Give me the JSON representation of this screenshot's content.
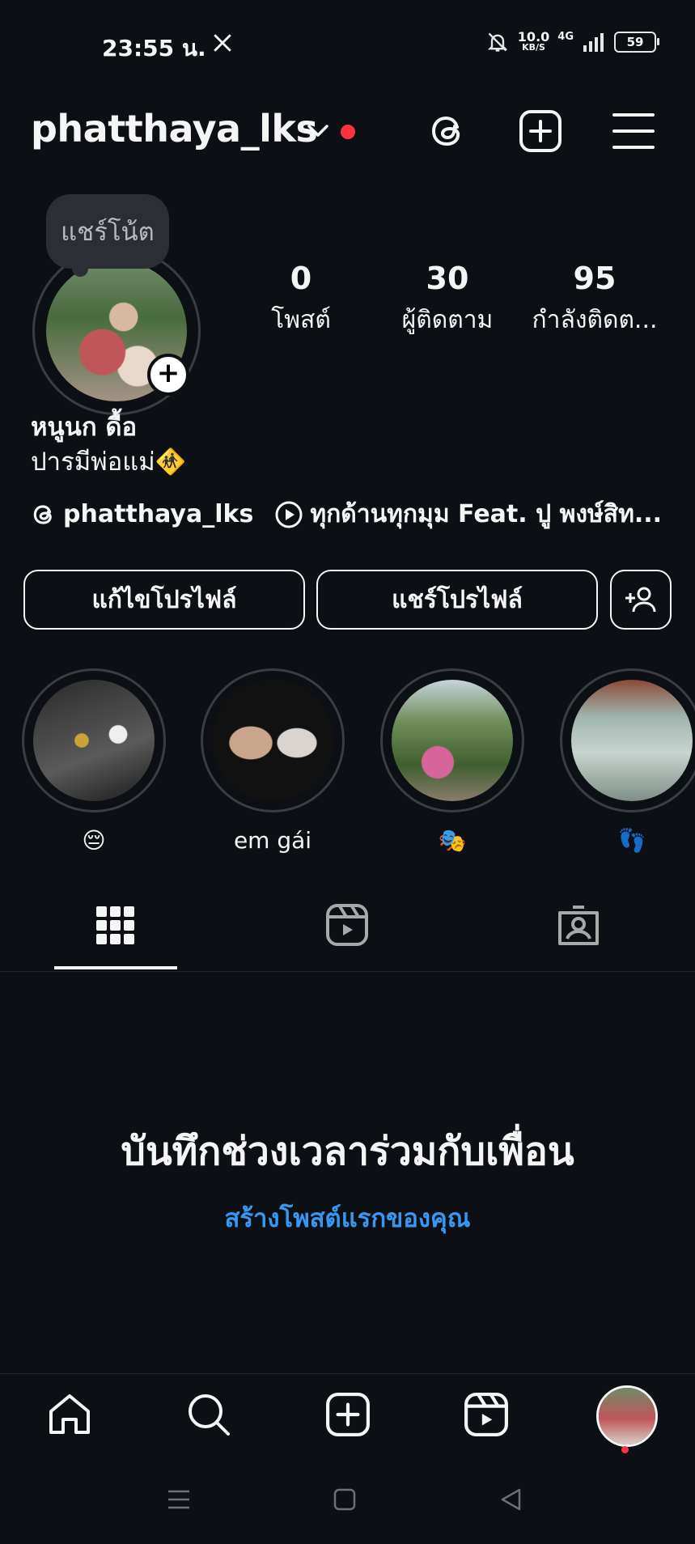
{
  "status": {
    "time": "23:55 น.",
    "net_speed_value": "10.0",
    "net_speed_unit": "KB/S",
    "network": "4G",
    "battery": "59"
  },
  "header": {
    "username": "phatthaya_lks"
  },
  "note": {
    "text": "แชร์โน้ต"
  },
  "stats": {
    "posts_count": "0",
    "posts_label": "โพสต์",
    "followers_count": "30",
    "followers_label": "ผู้ติดตาม",
    "following_count": "95",
    "following_label": "กำลังติดต..."
  },
  "profile": {
    "name": "หนูนก ดื้อ",
    "bio": "ปารมีพ่อแม่🚸",
    "threads_handle": "phatthaya_lks",
    "music": "ทุกด้านทุกมุม Feat. ปู พงษ์สิท..."
  },
  "buttons": {
    "edit_profile": "แก้ไขโปรไฟล์",
    "share_profile": "แชร์โปรไฟล์"
  },
  "highlights": [
    {
      "label": "😔"
    },
    {
      "label": "em gái"
    },
    {
      "label": "🎭"
    },
    {
      "label": "👣"
    }
  ],
  "empty_state": {
    "title": "บันทึกช่วงเวลาร่วมกับเพื่อน",
    "link": "สร้างโพสต์แรกของคุณ"
  },
  "colors": {
    "background": "#0c1014",
    "accent_link": "#3897f0",
    "notification_dot": "#ff3040"
  },
  "icons": [
    "x-logo-icon",
    "mute-icon",
    "signal-icon",
    "chevron-down-icon",
    "threads-icon",
    "create-icon",
    "menu-icon",
    "plus-icon",
    "play-icon",
    "add-person-icon",
    "grid-icon",
    "reels-icon",
    "tagged-icon",
    "home-icon",
    "search-icon",
    "reels-nav-icon"
  ]
}
